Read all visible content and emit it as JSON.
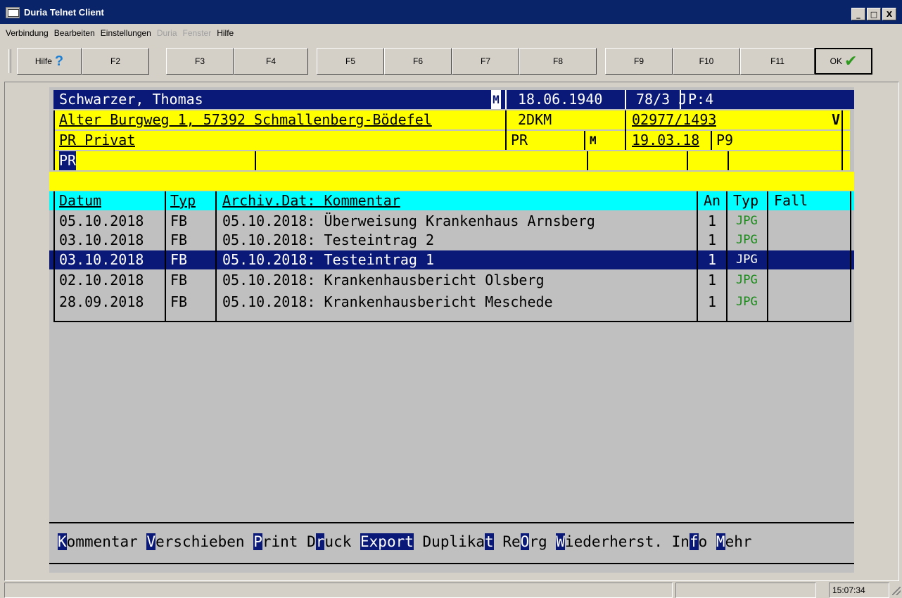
{
  "window": {
    "title": "Duria Telnet Client",
    "min_glyph": "_",
    "max_glyph": "□",
    "close_glyph": "X"
  },
  "menu": [
    {
      "label": "Verbindung",
      "disabled": false
    },
    {
      "label": "Bearbeiten",
      "disabled": false
    },
    {
      "label": "Einstellungen",
      "disabled": false
    },
    {
      "label": "Duria",
      "disabled": true
    },
    {
      "label": "Fenster",
      "disabled": true
    },
    {
      "label": "Hilfe",
      "disabled": false
    }
  ],
  "toolbar": {
    "help_label": "Hilfe",
    "help_icon": "question-mark-icon",
    "help_glyph": "?",
    "f2": "F2",
    "f3": "F3",
    "f4": "F4",
    "f5": "F5",
    "f6": "F6",
    "f7": "F7",
    "f8": "F8",
    "f9": "F9",
    "f10": "F10",
    "f11": "F11",
    "ok_label": "OK",
    "ok_icon": "checkmark-icon",
    "ok_glyph": "✔"
  },
  "patient": {
    "name": "Schwarzer, Thomas",
    "sex_flag": "M",
    "birthdate": "18.06.1940",
    "age": "78/3 J",
    "p": "P:4",
    "address": "Alter Burgweg 1, 57392 Schmallenberg-Bödefel",
    "code": "2DKM",
    "phone": "02977/1493",
    "v_flag": "V",
    "insurance": "PR Privat",
    "ins_code": "PR",
    "ins_m": "M",
    "ins_date": "19.03.18",
    "ins_p": "P9",
    "input_value": "PR"
  },
  "table": {
    "headers": {
      "datum": "Datum",
      "typ": "Typ",
      "kommentar": "Archiv.Dat: Kommentar",
      "an": "An",
      "typ2": "Typ",
      "fall": "Fall"
    },
    "rows": [
      {
        "datum": "05.10.2018",
        "typ": "FB",
        "kommentar": "05.10.2018: Überweisung Krankenhaus Arnsberg",
        "an": "1",
        "typ2": "JPG",
        "fall": ""
      },
      {
        "datum": "03.10.2018",
        "typ": "FB",
        "kommentar": "05.10.2018: Testeintrag 2",
        "an": "1",
        "typ2": "JPG",
        "fall": ""
      },
      {
        "datum": "03.10.2018",
        "typ": "FB",
        "kommentar": "05.10.2018: Testeintrag 1",
        "an": "1",
        "typ2": "JPG",
        "fall": ""
      },
      {
        "datum": "02.10.2018",
        "typ": "FB",
        "kommentar": "05.10.2018: Krankenhausbericht Olsberg",
        "an": "1",
        "typ2": "JPG",
        "fall": ""
      },
      {
        "datum": "28.09.2018",
        "typ": "FB",
        "kommentar": "05.10.2018: Krankenhausbericht Meschede",
        "an": "1",
        "typ2": "JPG",
        "fall": ""
      }
    ],
    "selected_index": 2
  },
  "actions": [
    {
      "hotkey": "K",
      "rest": "ommentar"
    },
    {
      "hotkey": "V",
      "rest": "erschieben"
    },
    {
      "hotkey": "P",
      "rest": "rint"
    },
    {
      "pre": "D",
      "hotkey": "r",
      "rest": "uck"
    },
    {
      "hotkey": "Export",
      "rest": ""
    },
    {
      "pre": "Duplika",
      "hotkey": "t",
      "rest": ""
    },
    {
      "pre": "Re",
      "hotkey": "O",
      "rest": "rg"
    },
    {
      "hotkey": "W",
      "rest": "iederherst."
    },
    {
      "pre": "In",
      "hotkey": "f",
      "rest": "o"
    },
    {
      "hotkey": "M",
      "rest": "ehr"
    }
  ],
  "status": {
    "time": "15:07:34"
  },
  "colors": {
    "title_bg": "#0a246a",
    "selection_bg": "#0a1978",
    "header_yellow": "#ffff00",
    "table_header_cyan": "#00ffff",
    "jpg_green": "#1a8a1a"
  }
}
